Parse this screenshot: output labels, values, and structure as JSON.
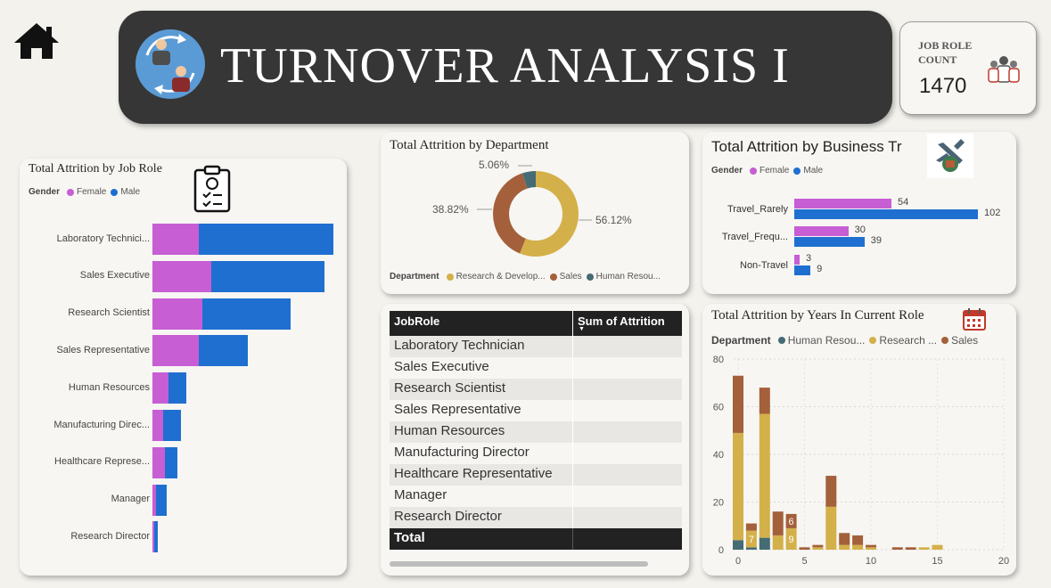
{
  "header": {
    "title": "TURNOVER ANALYSIS I",
    "kpi_label": "JOB ROLE COUNT",
    "kpi_value": "1470"
  },
  "colors": {
    "female": "#c75ed4",
    "male": "#1f6fd1",
    "research_dev": "#d4b04a",
    "sales": "#a3603a",
    "human_resources": "#456b74",
    "banner": "#363636"
  },
  "icons": [
    "home-icon",
    "people-exchange-icon",
    "team-icon",
    "clipboard-icon",
    "airplane-icon",
    "calendar-icon"
  ],
  "job_role_chart": {
    "title": "Total Attrition by Job Role",
    "legend_title": "Gender",
    "legend": [
      "Female",
      "Male"
    ],
    "rows": [
      {
        "label": "Laboratory Technici...",
        "female": 26,
        "male": 76
      },
      {
        "label": "Sales Executive",
        "female": 33,
        "male": 64
      },
      {
        "label": "Research Scientist",
        "female": 28,
        "male": 50
      },
      {
        "label": "Sales Representative",
        "female": 26,
        "male": 28
      },
      {
        "label": "Human Resources",
        "female": 9,
        "male": 10
      },
      {
        "label": "Manufacturing Direc...",
        "female": 6,
        "male": 10
      },
      {
        "label": "Healthcare Represe...",
        "female": 7,
        "male": 7
      },
      {
        "label": "Manager",
        "female": 2,
        "male": 6
      },
      {
        "label": "Research Director",
        "female": 1,
        "male": 2
      }
    ],
    "max": 108
  },
  "department_chart": {
    "title": "Total Attrition by Department",
    "legend_title": "Department",
    "legend": [
      "Research & Develop...",
      "Sales",
      "Human Resou..."
    ],
    "slices": [
      {
        "name": "Research & Development",
        "pct": 56.12,
        "label": "56.12%"
      },
      {
        "name": "Sales",
        "pct": 38.82,
        "label": "38.82%"
      },
      {
        "name": "Human Resources",
        "pct": 5.06,
        "label": "5.06%"
      }
    ]
  },
  "travel_chart": {
    "title": "Total Attrition by Business Tr",
    "legend_title": "Gender",
    "legend": [
      "Female",
      "Male"
    ],
    "rows": [
      {
        "label": "Travel_Rarely",
        "female": 54,
        "male": 102
      },
      {
        "label": "Travel_Frequ...",
        "female": 30,
        "male": 39
      },
      {
        "label": "Non-Travel",
        "female": 3,
        "male": 9
      }
    ],
    "max": 102
  },
  "table": {
    "columns": [
      "JobRole",
      "Sum of Attrition"
    ],
    "rows": [
      "Laboratory Technician",
      "Sales Executive",
      "Research Scientist",
      "Sales Representative",
      "Human Resources",
      "Manufacturing Director",
      "Healthcare Representative",
      "Manager",
      "Research Director"
    ],
    "total_label": "Total"
  },
  "years_chart": {
    "title": "Total Attrition by Years In Current Role",
    "legend_title": "Department",
    "legend": [
      "Human Resou...",
      "Research ...",
      "Sales"
    ],
    "y_ticks": [
      "0",
      "20",
      "40",
      "60",
      "80"
    ],
    "x_ticks": [
      "0",
      "5",
      "10",
      "15",
      "20"
    ],
    "ylim": [
      0,
      80
    ],
    "xlim": [
      0,
      20
    ],
    "bars": [
      {
        "x": 0,
        "hr": 4,
        "rd": 45,
        "sales": 24
      },
      {
        "x": 1,
        "hr": 1,
        "rd": 7,
        "sales": 3
      },
      {
        "x": 2,
        "hr": 5,
        "rd": 52,
        "sales": 11
      },
      {
        "x": 3,
        "hr": 0,
        "rd": 6,
        "sales": 10
      },
      {
        "x": 4,
        "hr": 0,
        "rd": 9,
        "sales": 6
      },
      {
        "x": 5,
        "hr": 0,
        "rd": 0,
        "sales": 1
      },
      {
        "x": 6,
        "hr": 0,
        "rd": 1,
        "sales": 1
      },
      {
        "x": 7,
        "hr": 0,
        "rd": 18,
        "sales": 13
      },
      {
        "x": 8,
        "hr": 0,
        "rd": 2,
        "sales": 5
      },
      {
        "x": 9,
        "hr": 0,
        "rd": 2,
        "sales": 4
      },
      {
        "x": 10,
        "hr": 0,
        "rd": 1,
        "sales": 1
      },
      {
        "x": 12,
        "hr": 0,
        "rd": 0,
        "sales": 1
      },
      {
        "x": 13,
        "hr": 0,
        "rd": 0,
        "sales": 1
      },
      {
        "x": 14,
        "hr": 0,
        "rd": 1,
        "sales": 0
      },
      {
        "x": 15,
        "hr": 0,
        "rd": 2,
        "sales": 0
      }
    ],
    "bar_labels": [
      {
        "x": 1,
        "text": "7"
      },
      {
        "x": 4,
        "text": "9"
      },
      {
        "x": 4,
        "text": "6",
        "part": "sales"
      }
    ]
  }
}
